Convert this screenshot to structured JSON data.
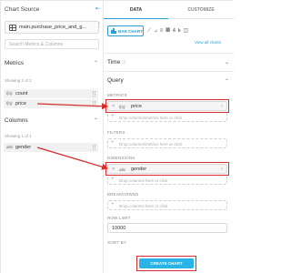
{
  "chart_source": {
    "title": "Chart Source",
    "dataset": "main.purchase_price_and_g...",
    "search_placeholder": "Search Metrics & Columns"
  },
  "metrics": {
    "title": "Metrics",
    "showing": "Showing 2 of 2",
    "items": [
      {
        "type": "f(x)",
        "name": "count"
      },
      {
        "type": "f(x)",
        "name": "price"
      }
    ]
  },
  "columns": {
    "title": "Columns",
    "showing": "Showing 1 of 1",
    "items": [
      {
        "type": "abc",
        "name": "gender"
      }
    ]
  },
  "tabs": {
    "data": "DATA",
    "customize": "CUSTOMIZE"
  },
  "chart_type": {
    "selected": "BAR CHART",
    "view_all": "View all charts",
    "icons": [
      "line-chart-icon",
      "area-chart-icon",
      "bar-chart-horizontal-icon",
      "table-icon",
      "big-number-icon",
      "more-charts-icon"
    ]
  },
  "sections": {
    "time": "Time",
    "query": "Query"
  },
  "query": {
    "metrics_label": "METRICS",
    "metric_pill": {
      "type": "f(x)",
      "name": "price"
    },
    "metrics_drop": "Drop columns/metrics here or click",
    "filters_label": "FILTERS",
    "filters_drop": "Drop columns/metrics here or click",
    "dimensions_label": "DIMENSIONS",
    "dimension_pill": {
      "type": "abc",
      "name": "gender"
    },
    "dimensions_drop": "Drop columns here or click",
    "breakdowns_label": "BREAKDOWNS",
    "breakdowns_drop": "Drop columns here or click",
    "row_limit_label": "ROW LIMIT",
    "row_limit_value": "10000",
    "sort_by_label": "SORT BY"
  },
  "actions": {
    "create_chart": "CREATE CHART"
  },
  "colors": {
    "accent": "#2ab3e6",
    "highlight": "#d62e2e"
  }
}
